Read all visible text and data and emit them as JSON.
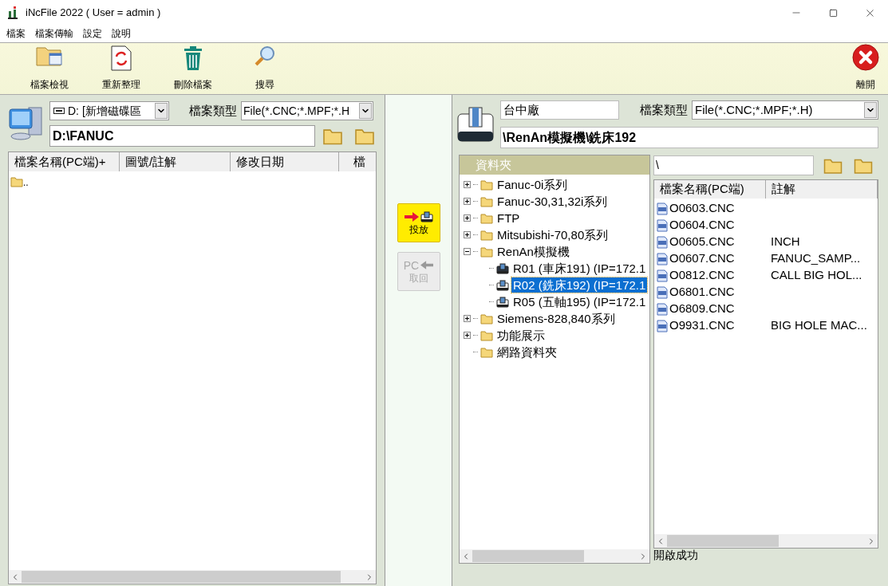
{
  "window": {
    "title": "iNcFile 2022 ( User = admin )"
  },
  "menu": [
    "檔案",
    "檔案傳輸",
    "設定",
    "說明"
  ],
  "toolbar": {
    "buttons": [
      {
        "label": "檔案檢視",
        "kind": "view"
      },
      {
        "label": "重新整理",
        "kind": "refresh"
      },
      {
        "label": "刪除檔案",
        "kind": "delete"
      },
      {
        "label": "搜尋",
        "kind": "search"
      }
    ],
    "exit_label": "離開"
  },
  "left": {
    "drive": "D: [新增磁碟區",
    "file_type_label": "檔案類型",
    "file_type": "File(*.CNC;*.MPF;*.H",
    "path": "D:\\FANUC",
    "columns": [
      "檔案名稱(PC端)+",
      "圖號/註解",
      "修改日期",
      "檔"
    ],
    "rows": [
      {
        "name": ".."
      }
    ]
  },
  "transfer": [
    {
      "kind": "send",
      "label": "投放",
      "disabled": false
    },
    {
      "kind": "fetch",
      "icon_text": "PC",
      "label": "取回",
      "disabled": true
    }
  ],
  "right": {
    "site": "台中廠",
    "file_type_label": "檔案類型",
    "file_type": "File(*.CNC;*.MPF;*.H)",
    "path": "\\RenAn模擬機\\銑床192",
    "tree": {
      "header": "資料夾",
      "items": [
        {
          "label": "Fanuc-0i系列",
          "kind": "folder",
          "expanded": false,
          "selected": false
        },
        {
          "label": "Fanuc-30,31,32i系列",
          "kind": "folder",
          "expanded": false,
          "selected": false
        },
        {
          "label": "FTP",
          "kind": "folder",
          "expanded": false,
          "selected": false
        },
        {
          "label": "Mitsubishi-70,80系列",
          "kind": "folder",
          "expanded": false,
          "selected": false
        },
        {
          "label": "RenAn模擬機",
          "kind": "folder",
          "expanded": true,
          "selected": false,
          "children": [
            {
              "label": "R01 (車床191) (IP=172.1",
              "kind": "lathe",
              "selected": false
            },
            {
              "label": "R02 (銑床192) (IP=172.1",
              "kind": "mill",
              "selected": true
            },
            {
              "label": "R05 (五軸195) (IP=172.1",
              "kind": "mill",
              "selected": false
            }
          ]
        },
        {
          "label": "Siemens-828,840系列",
          "kind": "folder",
          "expanded": false,
          "selected": false
        },
        {
          "label": "功能展示",
          "kind": "folder",
          "expanded": false,
          "selected": false
        },
        {
          "label": "網路資料夾",
          "kind": "folder",
          "selected": false
        }
      ]
    },
    "file_path": "\\",
    "columns": [
      "檔案名稱(PC端)",
      "註解"
    ],
    "rows": [
      {
        "name": "O0603.CNC"
      },
      {
        "name": "O0604.CNC"
      },
      {
        "name": "O0605.CNC",
        "comment": "INCH"
      },
      {
        "name": "O0607.CNC",
        "comment": "FANUC_SAMP..."
      },
      {
        "name": "O0812.CNC",
        "comment": "CALL BIG HOL..."
      },
      {
        "name": "O6801.CNC"
      },
      {
        "name": "O6809.CNC"
      },
      {
        "name": "O9931.CNC",
        "comment": "BIG HOLE MAC..."
      }
    ],
    "status": "開啟成功"
  }
}
